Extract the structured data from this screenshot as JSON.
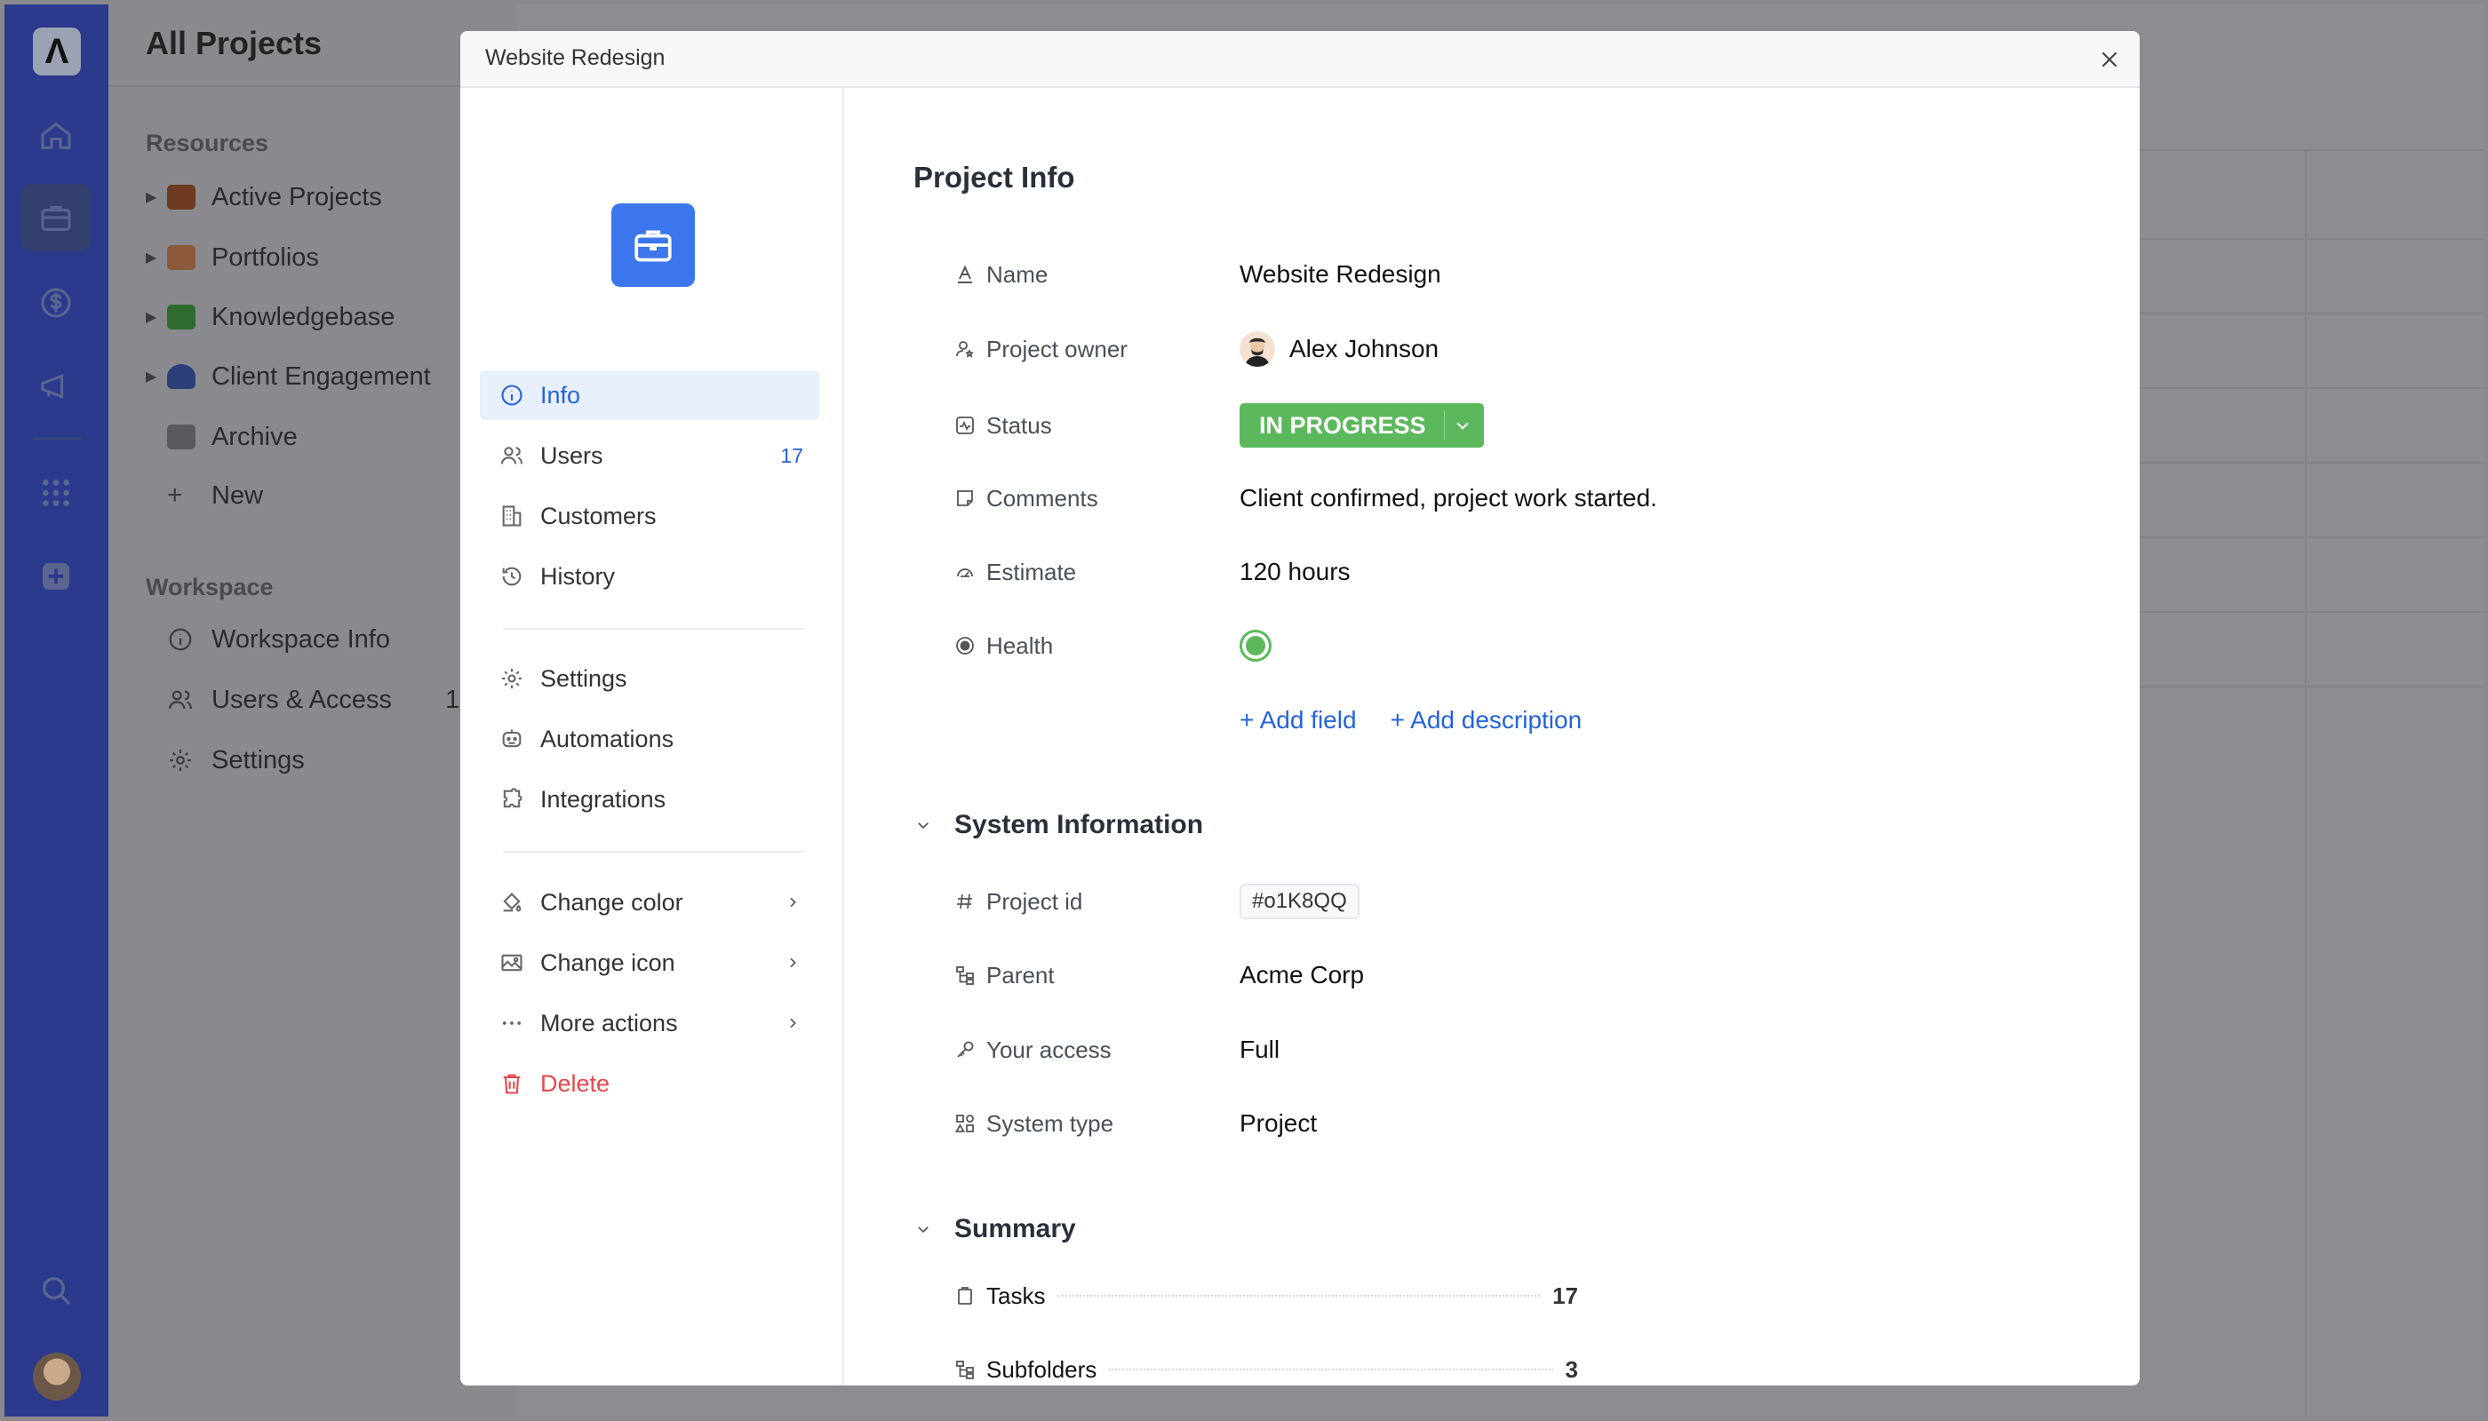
{
  "background": {
    "page_title": "All Projects",
    "resources_heading": "Resources",
    "resources": [
      {
        "label": "Active Projects",
        "color": "#6b3a1f"
      },
      {
        "label": "Portfolios",
        "color": "#8a5a3a"
      },
      {
        "label": "Knowledgebase",
        "color": "#2f6b2f"
      },
      {
        "label": "Client Engagement",
        "color": "#2b3f7a"
      },
      {
        "label": "Archive",
        "color": "#5a5a5e"
      },
      {
        "label": "New"
      }
    ],
    "workspace_heading": "Workspace",
    "workspace": [
      {
        "label": "Workspace Info"
      },
      {
        "label": "Users & Access",
        "count": "1"
      },
      {
        "label": "Settings"
      }
    ]
  },
  "modal": {
    "title": "Website Redesign",
    "nav": {
      "info": "Info",
      "users": "Users",
      "users_count": "17",
      "customers": "Customers",
      "history": "History",
      "settings": "Settings",
      "automations": "Automations",
      "integrations": "Integrations",
      "change_color": "Change color",
      "change_icon": "Change icon",
      "more_actions": "More actions",
      "delete": "Delete"
    },
    "info": {
      "heading": "Project Info",
      "fields": {
        "name_label": "Name",
        "name_value": "Website Redesign",
        "owner_label": "Project owner",
        "owner_value": "Alex Johnson",
        "status_label": "Status",
        "status_value": "IN PROGRESS",
        "comments_label": "Comments",
        "comments_value": "Client confirmed, project work started.",
        "estimate_label": "Estimate",
        "estimate_value": "120 hours",
        "health_label": "Health"
      },
      "add_field": "+ Add field",
      "add_description": "+ Add description"
    },
    "system": {
      "heading": "System Information",
      "project_id_label": "Project id",
      "project_id_value": "#o1K8QQ",
      "parent_label": "Parent",
      "parent_value": "Acme Corp",
      "access_label": "Your access",
      "access_value": "Full",
      "type_label": "System type",
      "type_value": "Project"
    },
    "summary": {
      "heading": "Summary",
      "tasks_label": "Tasks",
      "tasks_value": "17",
      "subfolders_label": "Subfolders",
      "subfolders_value": "3"
    }
  },
  "colors": {
    "accent": "#2563d8",
    "status_green": "#5cb85c",
    "danger": "#e5484d",
    "project_icon": "#3b76ec"
  }
}
